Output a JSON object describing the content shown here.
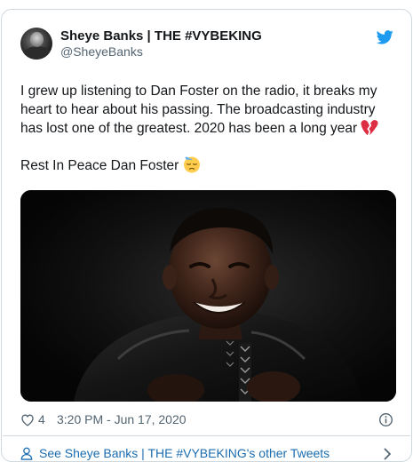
{
  "user": {
    "display_name": "Sheye Banks | THE #VYBEKING",
    "handle": "@SheyeBanks"
  },
  "tweet": {
    "paragraph_1": "I grew up listening to Dan Foster  on the radio, it breaks my heart to hear about his passing. The broadcasting industry has lost one of the greatest. 2020 has been a long year",
    "paragraph_1_emoji": "broken-heart-emoji",
    "paragraph_2": "Rest In Peace Dan Foster",
    "paragraph_2_emoji": "downcast-face-with-sweat-emoji"
  },
  "meta": {
    "like_count": "4",
    "timestamp": "3:20 PM - Jun 17, 2020"
  },
  "footer": {
    "label": "See Sheye Banks | THE #VYBEKING's other Tweets"
  },
  "icons": {
    "bird": "twitter-bird-icon",
    "heart": "heart-icon",
    "info": "info-icon",
    "person": "person-icon",
    "chevron": "chevron-right-icon"
  },
  "colors": {
    "twitter_blue": "#1d9bf0",
    "link_blue": "#1b6db0",
    "secondary_text": "#536471",
    "border": "#cfd9de",
    "broken_heart": "#e0243c"
  }
}
